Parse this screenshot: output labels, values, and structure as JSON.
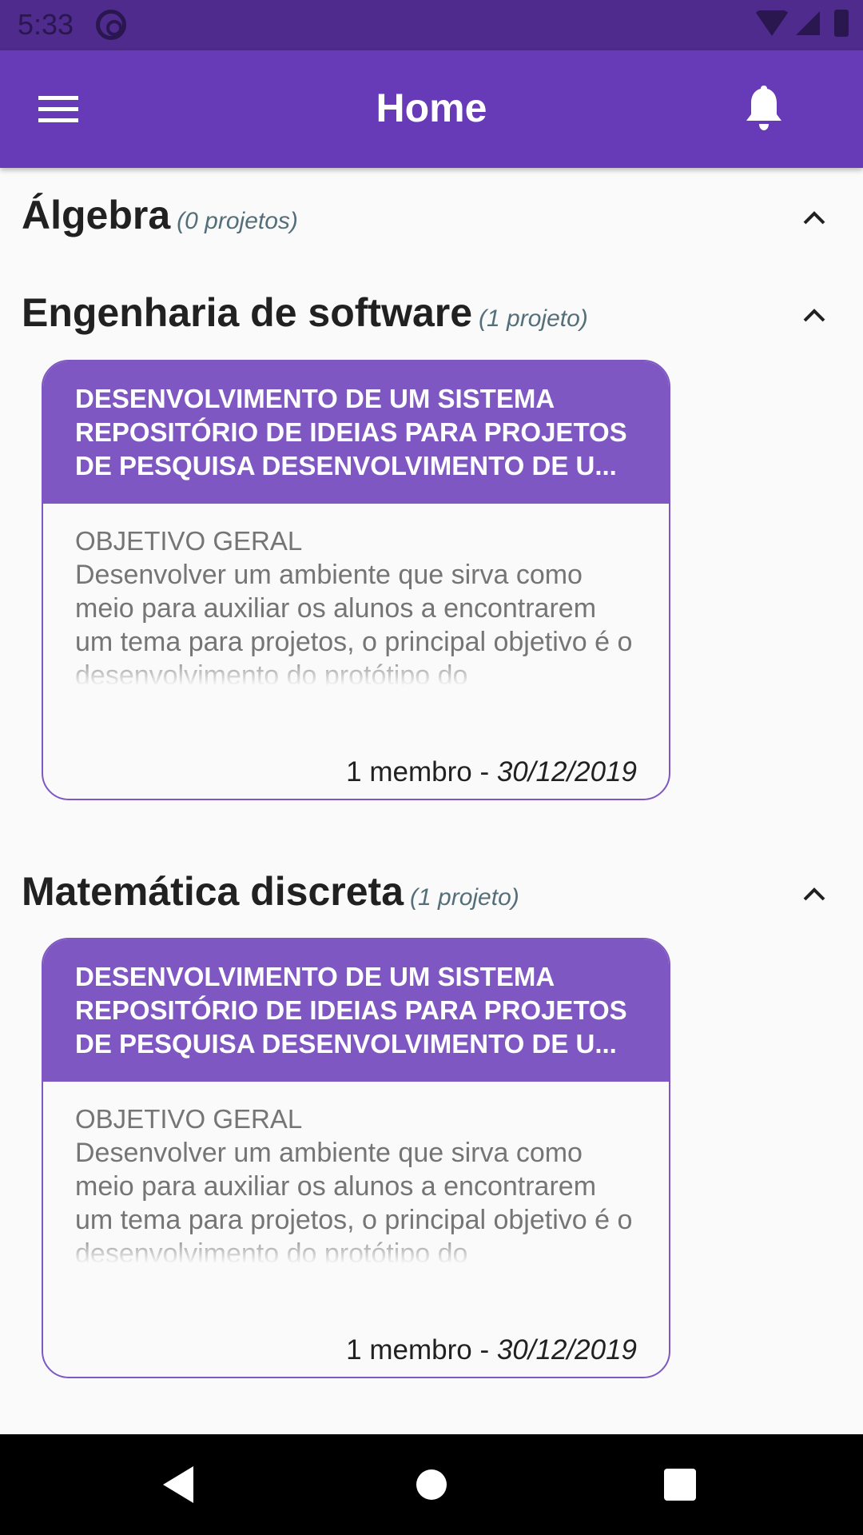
{
  "status_bar": {
    "time": "5:33"
  },
  "app_bar": {
    "title": "Home"
  },
  "sections": [
    {
      "title": "Álgebra",
      "count": "(0 projetos)"
    },
    {
      "title": "Engenharia de software",
      "count": "(1 projeto)"
    },
    {
      "title": "Matemática discreta",
      "count": "(1 projeto)"
    }
  ],
  "cards": [
    {
      "title": "DESENVOLVIMENTO DE UM SISTEMA REPOSITÓRIO DE IDEIAS PARA PROJETOS DE PESQUISA DESENVOLVIMENTO DE U...",
      "label": "OBJETIVO GERAL",
      "description": "Desenvolver um ambiente que sirva como meio para auxiliar os alunos a encontrarem um tema para projetos, o principal objetivo é o desenvolvimento do protótipo do",
      "members": "1 membro - ",
      "date": "30/12/2019"
    },
    {
      "title": "DESENVOLVIMENTO DE UM SISTEMA REPOSITÓRIO DE IDEIAS PARA PROJETOS DE PESQUISA DESENVOLVIMENTO DE U...",
      "label": "OBJETIVO GERAL",
      "description": "Desenvolver um ambiente que sirva como meio para auxiliar os alunos a encontrarem um tema para projetos, o principal objetivo é o desenvolvimento do protótipo do",
      "members": "1 membro - ",
      "date": "30/12/2019"
    }
  ],
  "colors": {
    "primary": "#673ab7",
    "card_accent": "#7e57c2",
    "status_bar": "#4e2b8c"
  },
  "icons": [
    "menu-icon",
    "bell-icon",
    "chevron-up-icon",
    "back-icon",
    "home-icon",
    "recents-icon"
  ]
}
